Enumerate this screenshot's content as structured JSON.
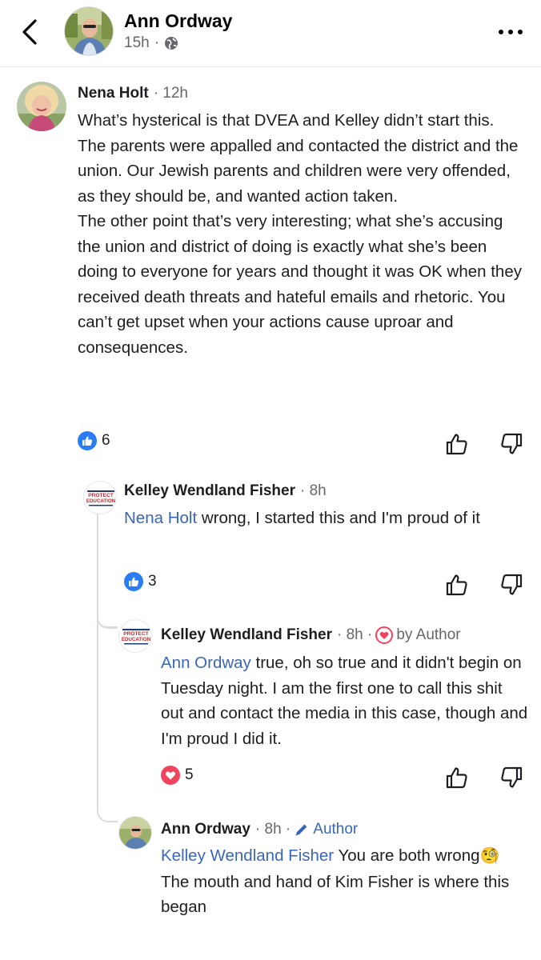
{
  "header": {
    "name": "Ann Ordway",
    "time": "15h",
    "separator": "·"
  },
  "comments": [
    {
      "author": "Nena Holt",
      "meta": "· 12h",
      "paragraphs": [
        "What’s hysterical is that DVEA and Kelley didn’t start this. The parents were appalled and contacted the district and the union. Our Jewish parents and children were very offended, as they should be, and wanted action taken.",
        "The other point that’s very interesting; what she’s accusing the union and district of doing is exactly what she’s been doing to everyone for years and thought it was OK when they received death threats and hateful emails and rhetoric. You can’t get upset when your actions cause uproar and consequences."
      ],
      "reaction": {
        "type": "like",
        "count": "6"
      }
    },
    {
      "author": "Kelley Wendland Fisher",
      "meta": "· 8h",
      "mention": "Nena Holt",
      "text": " wrong, I started this and I'm proud of it",
      "avatar_text": [
        "PROTECT",
        "EDUCATION"
      ],
      "reaction": {
        "type": "like",
        "count": "3"
      }
    },
    {
      "author": "Kelley Wendland Fisher",
      "meta": "· 8h ·",
      "badge": "by Author",
      "mention": "Ann Ordway",
      "text": " true, oh so true and it didn't begin on Tuesday night. I am the first one to call this shit out and contact the media in this case, though and I'm proud I did it.",
      "avatar_text": [
        "PROTECT",
        "EDUCATION"
      ],
      "reaction": {
        "type": "love",
        "count": "5"
      }
    },
    {
      "author": "Ann Ordway",
      "meta": "· 8h ·",
      "badge": "Author",
      "mention": "Kelley Wendland Fisher",
      "text_line1": " You are both wrong",
      "emoji": "🧐",
      "text_line2": "The mouth and hand of Kim Fisher is where this began"
    }
  ],
  "colors": {
    "link": "#3a66b8",
    "like": "#2c7cf6",
    "love": "#f2445e",
    "meta": "#65676b"
  },
  "icons": [
    "back-chevron-icon",
    "globe-icon",
    "more-dots-icon",
    "thumbs-up-icon",
    "thumbs-down-icon",
    "heart-icon",
    "pencil-icon"
  ]
}
